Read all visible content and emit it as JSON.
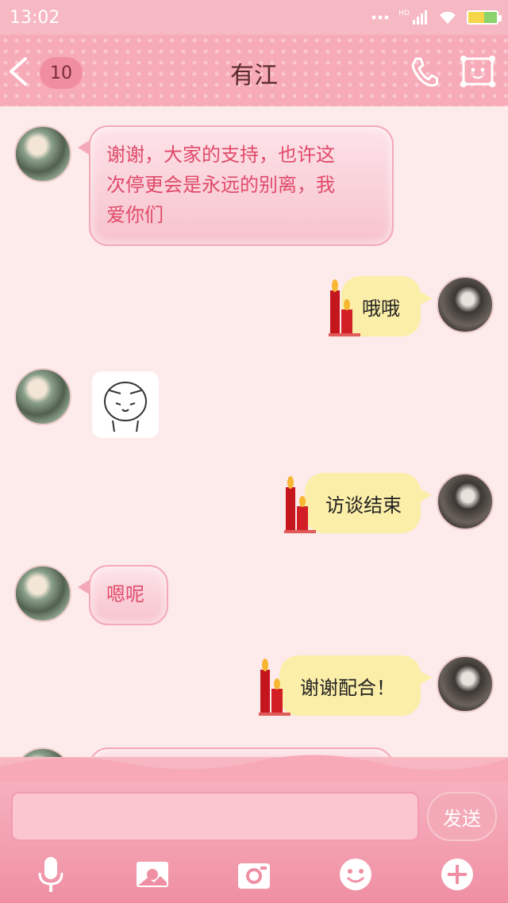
{
  "status": {
    "time": "13:02",
    "network": "HD"
  },
  "header": {
    "unread_count": "10",
    "contact_name": "有江"
  },
  "messages": [
    {
      "side": "left",
      "text_line1": "谢谢，大家的支持，也许这",
      "text_line2": "次停更会是永远的别离，我",
      "text_line3": "爱你们"
    },
    {
      "side": "right",
      "text": "哦哦"
    },
    {
      "side": "left",
      "type": "sticker",
      "sticker": "blushing-face-sticker"
    },
    {
      "side": "right",
      "text": "访谈结束"
    },
    {
      "side": "left",
      "text": "嗯呢"
    },
    {
      "side": "right",
      "text": "谢谢配合！"
    }
  ],
  "composer": {
    "input_value": "",
    "send_label": "发送"
  },
  "toolbar": [
    "microphone-icon",
    "photo-icon",
    "camera-icon",
    "smiley-icon",
    "plus-icon"
  ],
  "colors": {
    "accent": "#f7aab7",
    "bubble_left_text": "#e04a6a",
    "bubble_right_bg": "#fbeea8"
  }
}
